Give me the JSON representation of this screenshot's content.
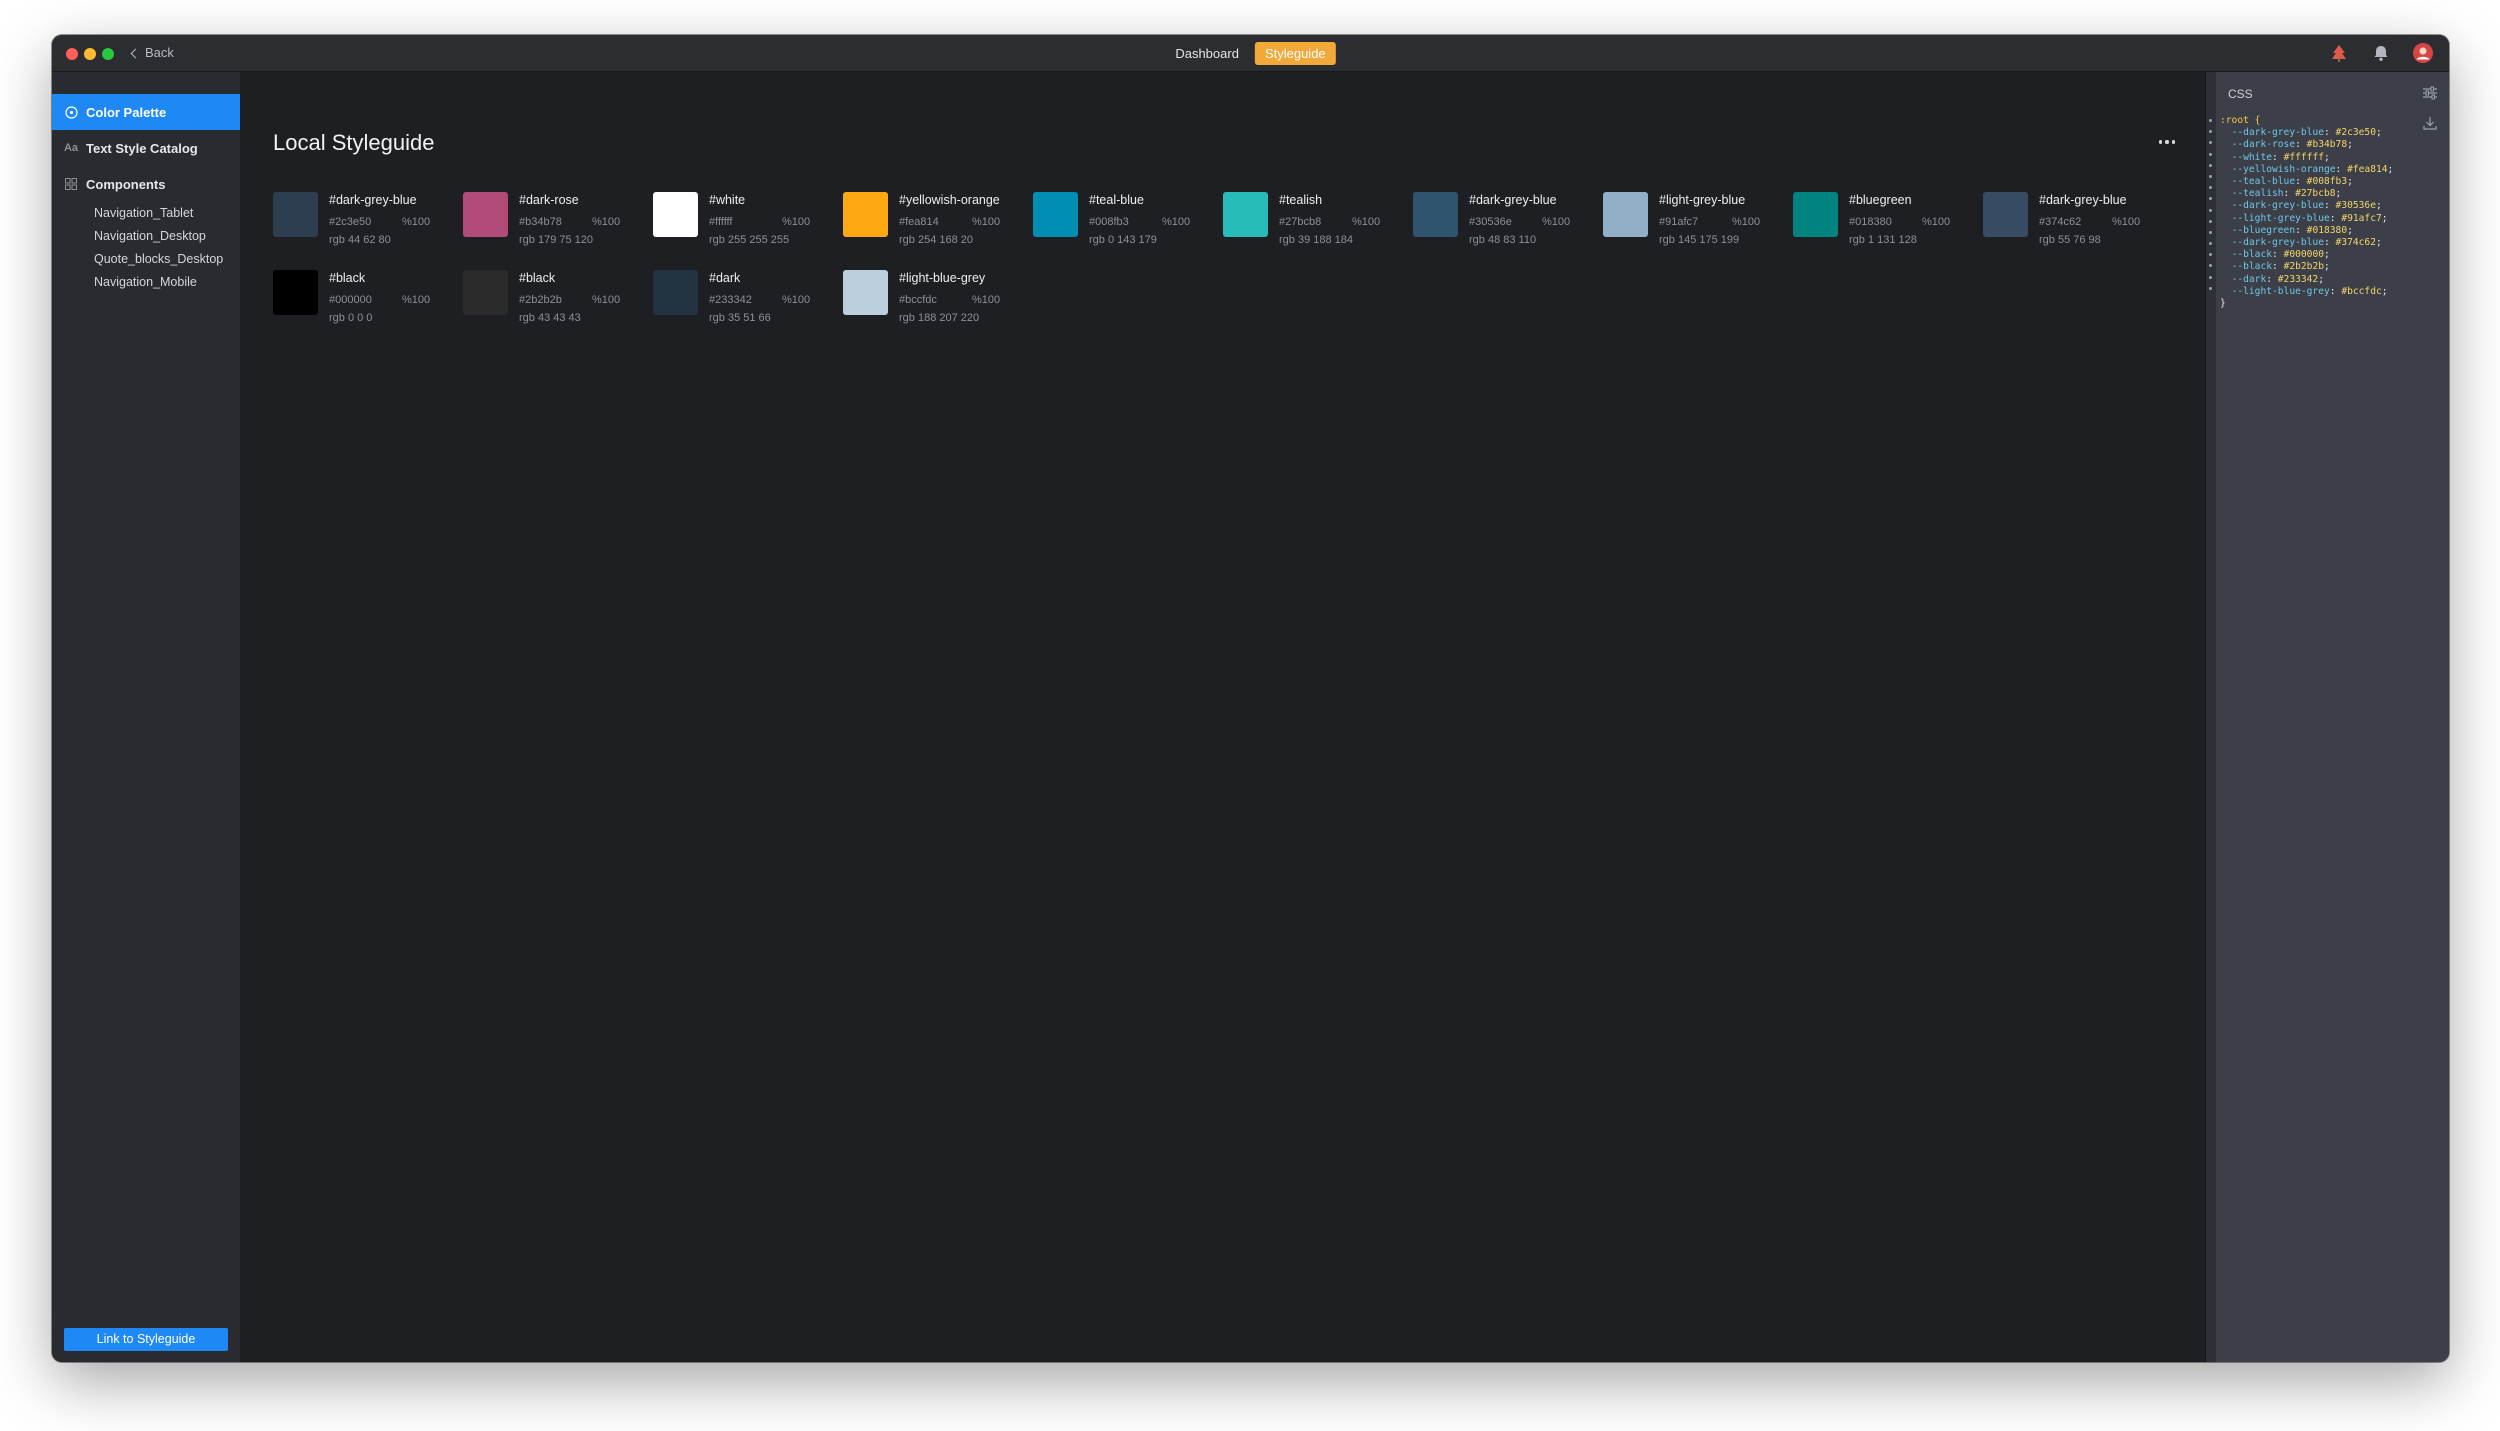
{
  "titlebar": {
    "back_label": "Back",
    "tabs": [
      {
        "label": "Dashboard",
        "active": false
      },
      {
        "label": "Styleguide",
        "active": true
      }
    ],
    "icons": [
      "tree-icon",
      "bell-icon",
      "avatar-icon"
    ]
  },
  "sidebar": {
    "items": [
      {
        "label": "Color Palette",
        "icon": "palette-icon",
        "active": true
      },
      {
        "label": "Text Style Catalog",
        "icon": "text-style-icon",
        "active": false
      },
      {
        "label": "Components",
        "icon": "components-icon",
        "active": false
      }
    ],
    "components": [
      "Navigation_Tablet",
      "Navigation_Desktop",
      "Quote_blocks_Desktop",
      "Navigation_Mobile"
    ],
    "link_button": "Link to Styleguide"
  },
  "main": {
    "title": "Local Styleguide"
  },
  "colors": [
    {
      "name": "#dark-grey-blue",
      "hex": "#2c3e50",
      "opacity": "%100",
      "rgb": "rgb 44 62 80",
      "color": "#2c3e50"
    },
    {
      "name": "#dark-rose",
      "hex": "#b34b78",
      "opacity": "%100",
      "rgb": "rgb 179 75 120",
      "color": "#b34b78"
    },
    {
      "name": "#white",
      "hex": "#ffffff",
      "opacity": "%100",
      "rgb": "rgb 255 255 255",
      "color": "#ffffff"
    },
    {
      "name": "#yellowish-orange",
      "hex": "#fea814",
      "opacity": "%100",
      "rgb": "rgb 254 168 20",
      "color": "#fea814"
    },
    {
      "name": "#teal-blue",
      "hex": "#008fb3",
      "opacity": "%100",
      "rgb": "rgb 0 143 179",
      "color": "#008fb3"
    },
    {
      "name": "#tealish",
      "hex": "#27bcb8",
      "opacity": "%100",
      "rgb": "rgb 39 188 184",
      "color": "#27bcb8"
    },
    {
      "name": "#dark-grey-blue",
      "hex": "#30536e",
      "opacity": "%100",
      "rgb": "rgb 48 83 110",
      "color": "#30536e"
    },
    {
      "name": "#light-grey-blue",
      "hex": "#91afc7",
      "opacity": "%100",
      "rgb": "rgb 145 175 199",
      "color": "#91afc7"
    },
    {
      "name": "#bluegreen",
      "hex": "#018380",
      "opacity": "%100",
      "rgb": "rgb 1 131 128",
      "color": "#018380"
    },
    {
      "name": "#dark-grey-blue",
      "hex": "#374c62",
      "opacity": "%100",
      "rgb": "rgb 55 76 98",
      "color": "#374c62"
    },
    {
      "name": "#black",
      "hex": "#000000",
      "opacity": "%100",
      "rgb": "rgb 0 0 0",
      "color": "#000000"
    },
    {
      "name": "#black",
      "hex": "#2b2b2b",
      "opacity": "%100",
      "rgb": "rgb 43 43 43",
      "color": "#2b2b2b"
    },
    {
      "name": "#dark",
      "hex": "#233342",
      "opacity": "%100",
      "rgb": "rgb 35 51 66",
      "color": "#233342"
    },
    {
      "name": "#light-blue-grey",
      "hex": "#bccfdc",
      "opacity": "%100",
      "rgb": "rgb 188 207 220",
      "color": "#bccfdc"
    }
  ],
  "css_panel": {
    "title": "CSS",
    "open": ":root {",
    "vars": [
      {
        "prop": "--dark-grey-blue",
        "val": "#2c3e50"
      },
      {
        "prop": "--dark-rose",
        "val": "#b34b78"
      },
      {
        "prop": "--white",
        "val": "#ffffff"
      },
      {
        "prop": "--yellowish-orange",
        "val": "#fea814"
      },
      {
        "prop": "--teal-blue",
        "val": "#008fb3"
      },
      {
        "prop": "--tealish",
        "val": "#27bcb8"
      },
      {
        "prop": "--dark-grey-blue",
        "val": "#30536e"
      },
      {
        "prop": "--light-grey-blue",
        "val": "#91afc7"
      },
      {
        "prop": "--bluegreen",
        "val": "#018380"
      },
      {
        "prop": "--dark-grey-blue",
        "val": "#374c62"
      },
      {
        "prop": "--black",
        "val": "#000000"
      },
      {
        "prop": "--black",
        "val": "#2b2b2b"
      },
      {
        "prop": "--dark",
        "val": "#233342"
      },
      {
        "prop": "--light-blue-grey",
        "val": "#bccfdc"
      }
    ],
    "close": "}"
  },
  "theme": {
    "accent": "#1e88f5",
    "tab_active": "#f3a83a",
    "background": "#1e1f23"
  }
}
